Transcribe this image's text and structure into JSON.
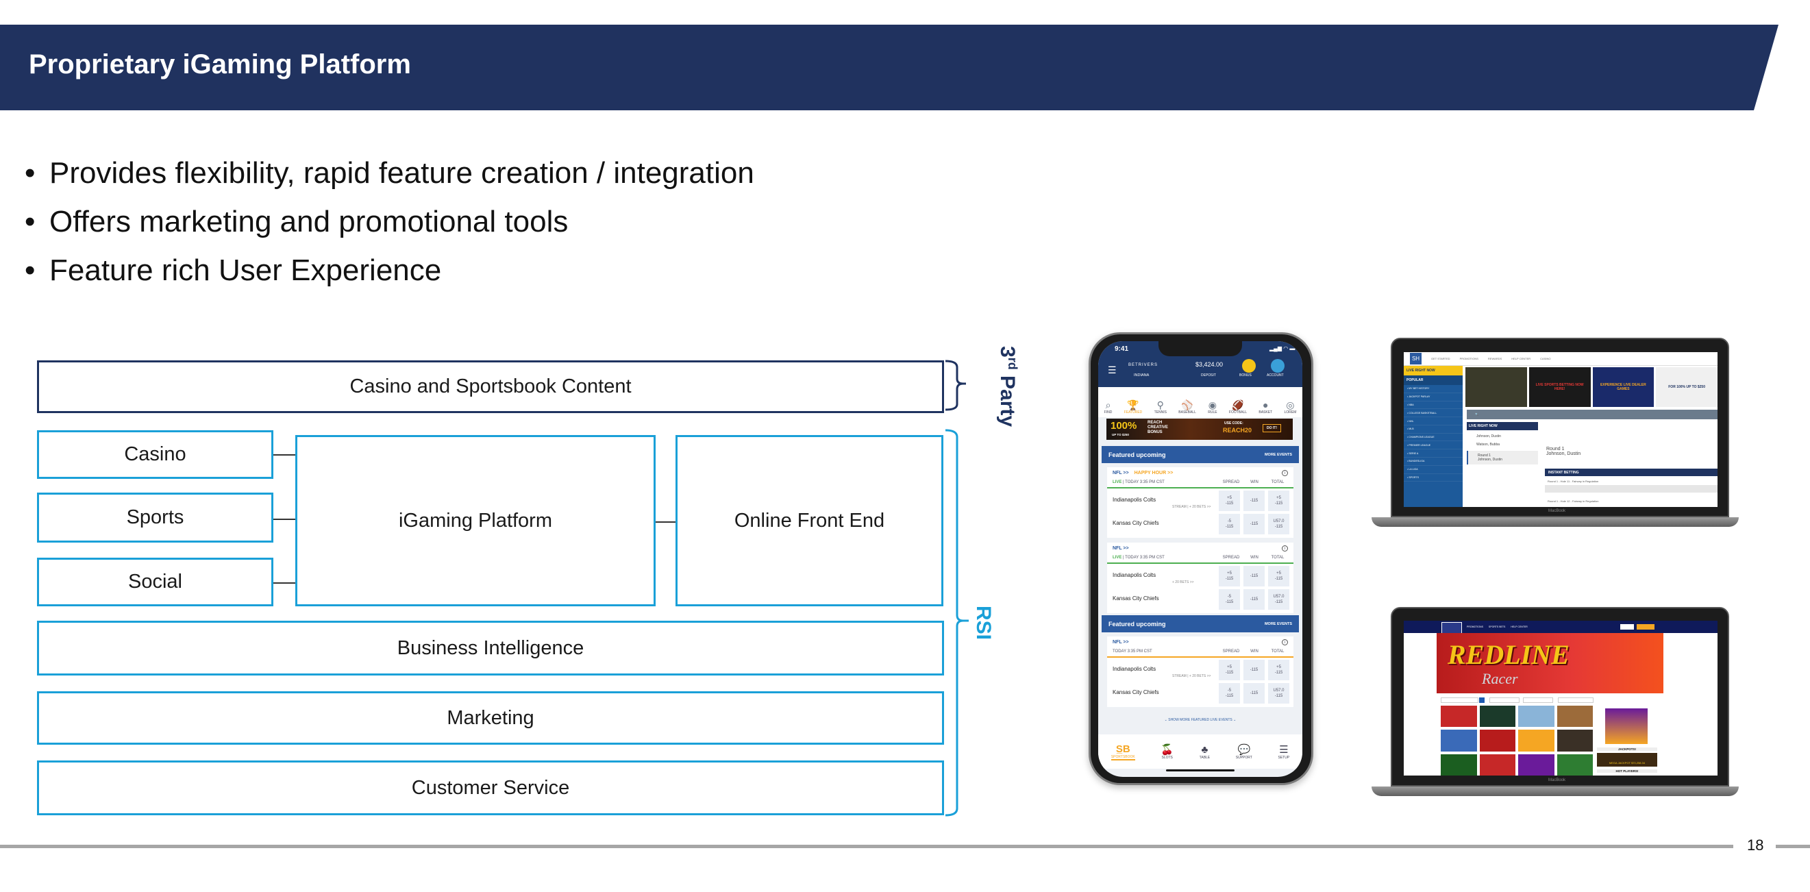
{
  "header": {
    "title": "Proprietary iGaming Platform"
  },
  "bullets": [
    "Provides flexibility, rapid feature creation / integration",
    "Offers marketing and promotional tools",
    "Feature rich User Experience"
  ],
  "diagram": {
    "third_party_box": "Casino and Sportsbook Content",
    "left_boxes": [
      "Casino",
      "Sports",
      "Social"
    ],
    "platform": "iGaming Platform",
    "front_end": "Online Front End",
    "rows": [
      "Business Intelligence",
      "Marketing",
      "Customer Service"
    ],
    "third_party_label": "3rd Party",
    "rsi_label": "RSI"
  },
  "colors": {
    "navy": "#20325f",
    "cyan": "#1aa0d8",
    "footer_line": "#a6a6a6"
  },
  "phone": {
    "time": "9:41",
    "brand": "BETRIVERS",
    "state": "INDIANA",
    "balance": "$3,424.00",
    "deposit": "DEPOSIT",
    "bonus": "BONUS",
    "account": "ACCOUNT",
    "sports": [
      "FIND",
      "FEATURED",
      "TENNIS",
      "BASEBALL",
      "RULE",
      "FOOTBALL",
      "BASKET",
      "LOREM"
    ],
    "banner": {
      "pct": "100%",
      "upto": "UP TO $250",
      "text": "REACH CREATIVE BONUS",
      "code_label": "USE CODE:",
      "code": "REACH20",
      "cta": "DO IT!"
    },
    "featured_title": "Featured upcoming",
    "more_events": "MORE EVENTS",
    "cards": [
      {
        "league": "NFL >>",
        "happy": "HAPPY HOUR >>",
        "live": "LIVE",
        "time": "| TODAY 3:35 PM CST",
        "bets": "STREAM | + 20 BETS >>",
        "rule": "#4caf50"
      },
      {
        "league": "NFL >>",
        "happy": "",
        "live": "LIVE",
        "time": "| TODAY 3:35 PM CST",
        "bets": "+ 20 BETS >>",
        "rule": "#4caf50"
      },
      {
        "league": "NFL >>",
        "happy": "",
        "live": "",
        "time": "TODAY 3:35 PM CST",
        "bets": "STREAM | + 20 BETS >>",
        "rule": "#f5a623"
      }
    ],
    "headers": [
      "SPREAD",
      "WIN",
      "TOTAL"
    ],
    "teams": [
      "Indianapolis Colts",
      "Kansas City Chiefs"
    ],
    "odds": [
      [
        "+5\n-115",
        "-115",
        "+5\n-115"
      ],
      [
        "-5\n-115",
        "-115",
        "U57.0\n-115"
      ]
    ],
    "show_more": "SHOW MORE FEATURED LIVE EVENTS",
    "nav": [
      "SPORTSBOOK",
      "SLOTS",
      "TABLE",
      "SUPPORT",
      "SETUP"
    ]
  },
  "laptop1": {
    "logo": "SH",
    "nav": [
      "GET STARTED",
      "PROMOTIONS",
      "REWARDS",
      "HELP CENTER",
      "CASINO"
    ],
    "live_now": "LIVE RIGHT NOW",
    "popular": "POPULAR",
    "menu": [
      "MY BET HISTORY",
      "JACKPOT PARLAY",
      "NBA",
      "COLLEGE BASKETBALL",
      "NHL",
      "MLB",
      "CHAMPIONS LEAGUE",
      "PREMIER LEAGUE",
      "SERIE A",
      "BUNDESLIGA",
      "LA LIGA",
      "SPORTS"
    ],
    "promo": [
      "LIVE SPORTS BETTING NOW HERE!",
      "EXPERIENCE LIVE DEALER GAMES",
      "FOR 100% UP TO $250"
    ],
    "live_panel": "LIVE RIGHT NOW",
    "players": [
      "Johnson, Dustin",
      "Watson, Bubba",
      "Round 1",
      "Johnson, Dustin"
    ],
    "detail": "Round 1\nJohnson, Dustin",
    "instant": "INSTANT BETTING",
    "markets": [
      "Round 1 - Hole 11 - Fairway in Regulation",
      "Round 1 - Hole 12 - Fairway in Regulation"
    ],
    "brand": "MacBook"
  },
  "laptop2": {
    "nav": [
      "PROMOTIONS",
      "SPORTS BETS",
      "HELP CENTER"
    ],
    "hero": "REDLINE",
    "hero_sub": "Racer",
    "jackpots": "JACKPOTS!",
    "mega": "MEGA JACKPOT  $70,258.34",
    "hot": "HOT PLAYERS!",
    "brand": "MacBook"
  },
  "footer": {
    "page": "18"
  }
}
